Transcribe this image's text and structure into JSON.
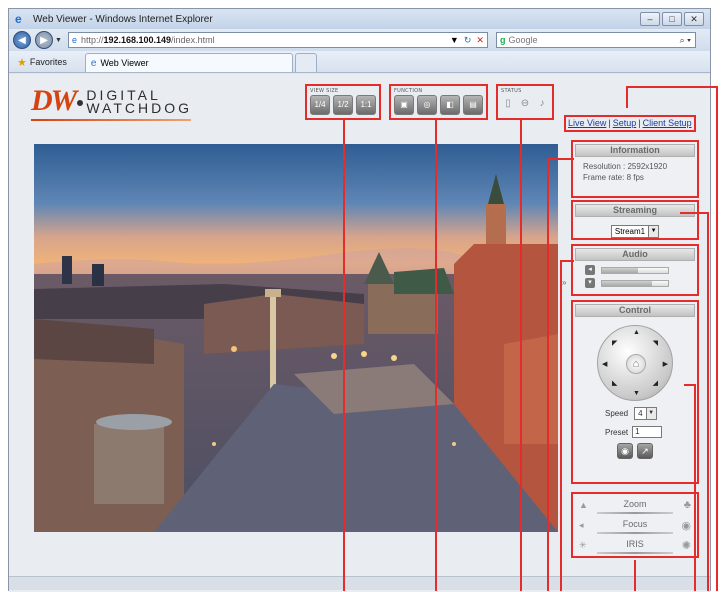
{
  "browser": {
    "title": "Web Viewer - Windows Internet Explorer",
    "url_prefix": "http://",
    "url_host": "192.168.100.149",
    "url_path": "/index.html",
    "search_placeholder": "Google",
    "favorites_label": "Favorites",
    "tab_label": "Web Viewer",
    "window_buttons": [
      "–",
      "□",
      "✕"
    ],
    "status_text": ""
  },
  "header": {
    "logo_mark": "DW",
    "logo_line1": "DIGITAL",
    "logo_line2": "WATCHDOG",
    "view_size_label": "VIEW SIZE",
    "view_size_buttons": [
      "1/4",
      "1/2",
      "1:1"
    ],
    "function_label": "FUNCTION",
    "function_buttons": [
      "▣",
      "◎",
      "◧",
      "▤"
    ],
    "status_label": "STATUS",
    "status_icons": [
      "▯",
      "⊖",
      "♪"
    ]
  },
  "nav": {
    "live_view": "Live View",
    "setup": "Setup",
    "client_setup": "Client Setup",
    "separator": "|"
  },
  "information": {
    "title": "Information",
    "resolution": "Resolution : 2592x1920",
    "frame_rate": "Frame rate: 8 fps"
  },
  "streaming": {
    "title": "Streaming",
    "selected": "Stream1"
  },
  "audio": {
    "title": "Audio",
    "speaker_level": 0.55,
    "mic_level": 0.75
  },
  "control": {
    "title": "Control",
    "speed_label": "Speed",
    "speed_value": "4",
    "preset_label": "Preset",
    "preset_value": "1"
  },
  "lens": {
    "zoom": "Zoom",
    "focus": "Focus",
    "iris": "IRIS"
  }
}
